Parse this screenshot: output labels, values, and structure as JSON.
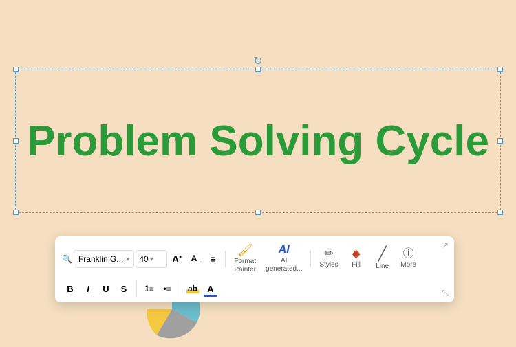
{
  "canvas": {
    "background_color": "#f5dfc0"
  },
  "text_box": {
    "title": "Problem Solving Cycle",
    "title_color": "#2a9a3a"
  },
  "toolbar": {
    "font_name": "Franklin G...",
    "font_size": "40",
    "font_size_label": "40",
    "search_icon": "🔍",
    "buttons_row1": [
      {
        "id": "increase-font",
        "icon": "A⁺",
        "label": ""
      },
      {
        "id": "decrease-font",
        "icon": "A⁻",
        "label": ""
      },
      {
        "id": "align",
        "icon": "≡",
        "label": ""
      }
    ],
    "buttons_row2": [
      {
        "id": "bold",
        "label": "B"
      },
      {
        "id": "italic",
        "label": "I"
      },
      {
        "id": "underline",
        "label": "U"
      },
      {
        "id": "strikethrough",
        "label": "S"
      },
      {
        "id": "list-ordered",
        "label": "1≡"
      },
      {
        "id": "list-bullet",
        "label": "•≡"
      },
      {
        "id": "text-highlight",
        "label": "ab"
      },
      {
        "id": "text-color",
        "label": "A"
      }
    ],
    "action_buttons": [
      {
        "id": "format-painter",
        "label": "Format\nPainter",
        "icon": "🖌"
      },
      {
        "id": "ai-generated",
        "label": "AI\ngenerated...",
        "icon": "AI"
      },
      {
        "id": "styles",
        "label": "Styles",
        "icon": "✏"
      },
      {
        "id": "fill",
        "label": "Fill",
        "icon": "◆"
      },
      {
        "id": "line",
        "label": "Line",
        "icon": "/"
      },
      {
        "id": "more",
        "label": "More",
        "icon": "ⓘ"
      }
    ],
    "collapse_icon": "↗",
    "expand_icon": "⤡"
  }
}
